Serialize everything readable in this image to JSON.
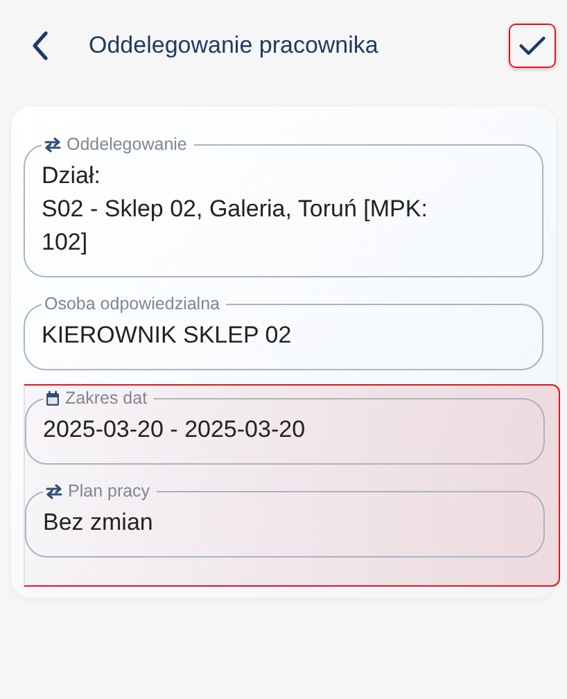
{
  "header": {
    "title": "Oddelegowanie pracownika",
    "confirm_highlighted": true
  },
  "sections": [
    {
      "highlighted": false,
      "fields": [
        {
          "label": "Oddelegowanie",
          "kind": "swap",
          "value": "Dział:\nS02 - Sklep 02, Galeria, Toruń [MPK: 102]"
        },
        {
          "label": "Osoba odpowiedzialna",
          "value": "KIEROWNIK SKLEP 02"
        }
      ]
    },
    {
      "highlighted": true,
      "fields": [
        {
          "label": "Zakres dat",
          "kind": "calendar",
          "value": "2025-03-20 - 2025-03-20"
        },
        {
          "label": "Plan pracy",
          "kind": "swap",
          "value": "Bez zmian"
        }
      ]
    }
  ]
}
